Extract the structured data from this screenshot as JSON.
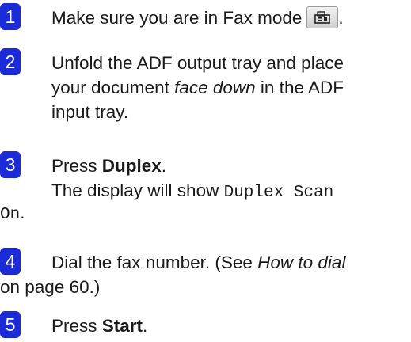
{
  "steps": [
    {
      "number": "1",
      "text_before": "Make sure you are in Fax mode",
      "icon": "fax-mode-key-icon",
      "text_after": "."
    },
    {
      "number": "2",
      "line1": "Unfold the ADF output tray and place",
      "line2_before": "your document ",
      "line2_italic": "face down",
      "line2_after": " in the ADF",
      "line3": "input tray."
    },
    {
      "number": "3",
      "line1_before": "Press ",
      "line1_bold": "Duplex",
      "line1_after": ".",
      "line2_before": "The display will show ",
      "line2_mono": "Duplex Scan",
      "line3_mono": "On",
      "line3_after": "."
    },
    {
      "number": "4",
      "line1_before": "Dial the fax number. (See ",
      "line1_italic": "How to dial",
      "line2": "on page 60.)"
    },
    {
      "number": "5",
      "line1_before": "Press ",
      "line1_bold": "Start",
      "line1_after": "."
    }
  ],
  "colors": {
    "step_badge": "#1b2bd8",
    "text": "#1a1a1a"
  }
}
